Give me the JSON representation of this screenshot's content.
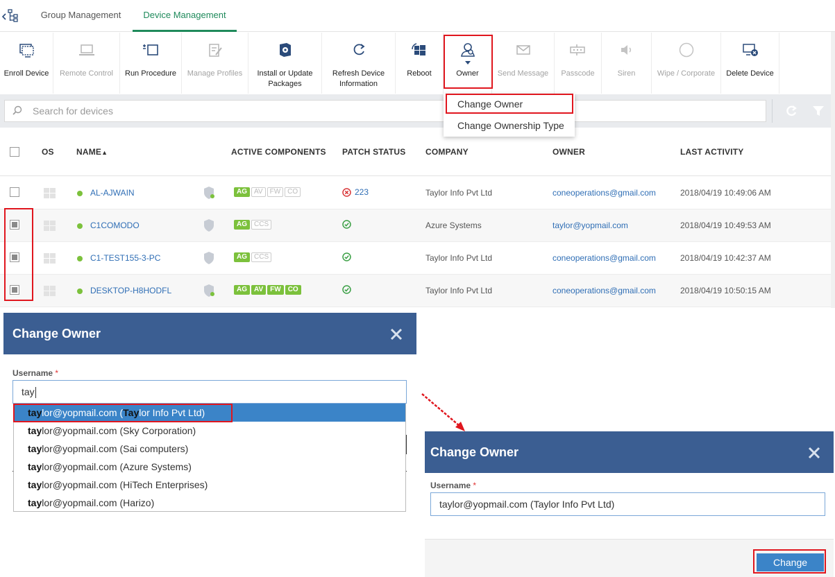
{
  "tabs": [
    {
      "label": "Group Management",
      "active": false
    },
    {
      "label": "Device Management",
      "active": true
    }
  ],
  "toolbar": {
    "enroll": "Enroll Device",
    "remote": "Remote Control",
    "run_procedure": "Run Procedure",
    "manage_profiles": "Manage Profiles",
    "install_line1": "Install or Update",
    "install_line2": "Packages",
    "refresh_line1": "Refresh Device",
    "refresh_line2": "Information",
    "reboot": "Reboot",
    "owner": "Owner",
    "send_message": "Send Message",
    "passcode": "Passcode",
    "siren": "Siren",
    "wipe": "Wipe / Corporate",
    "delete": "Delete Device"
  },
  "search": {
    "placeholder": "Search for devices"
  },
  "owner_menu": {
    "change_owner": "Change Owner",
    "change_ownership_type": "Change Ownership Type"
  },
  "table": {
    "headers": {
      "os": "OS",
      "name": "NAME",
      "active_components": "ACTIVE COMPONENTS",
      "patch_status": "PATCH STATUS",
      "company": "COMPANY",
      "owner": "OWNER",
      "last_activity": "LAST ACTIVITY"
    },
    "rows": [
      {
        "name": "AL-AJWAIN",
        "patch": "223",
        "company": "Taylor Info Pvt Ltd",
        "owner": "coneoperations@gmail.com",
        "last_activity": "2018/04/19 10:49:06 AM",
        "checked": false
      },
      {
        "name": "C1COMODO",
        "patch": "",
        "company": "Azure Systems",
        "owner": "taylor@yopmail.com",
        "last_activity": "2018/04/19 10:49:53 AM",
        "checked": true
      },
      {
        "name": "C1-TEST155-3-PC",
        "patch": "",
        "company": "Taylor Info Pvt Ltd",
        "owner": "coneoperations@gmail.com",
        "last_activity": "2018/04/19 10:42:37 AM",
        "checked": true
      },
      {
        "name": "DESKTOP-H8HODFL",
        "patch": "",
        "company": "Taylor Info Pvt Ltd",
        "owner": "coneoperations@gmail.com",
        "last_activity": "2018/04/19 10:50:15 AM",
        "checked": true
      }
    ],
    "badges": {
      "ag": "AG",
      "av": "AV",
      "fw": "FW",
      "co": "CO",
      "ccs": "CCS"
    }
  },
  "modal1": {
    "title": "Change Owner",
    "username_label": "Username",
    "required_mark": "*",
    "input_value": "tay",
    "suggestions": [
      {
        "bold": "tay",
        "rest": "lor@yopmail.com (",
        "bold2": "Tay",
        "rest2": "lor Info Pvt Ltd)"
      },
      {
        "bold": "tay",
        "rest": "lor@yopmail.com (Sky Corporation)"
      },
      {
        "bold": "tay",
        "rest": "lor@yopmail.com (Sai computers)"
      },
      {
        "bold": "tay",
        "rest": "lor@yopmail.com (Azure Systems)"
      },
      {
        "bold": "tay",
        "rest": "lor@yopmail.com (HiTech Enterprises)"
      },
      {
        "bold": "tay",
        "rest": "lor@yopmail.com (Harizo)"
      }
    ]
  },
  "modal2": {
    "title": "Change Owner",
    "username_label": "Username",
    "required_mark": "*",
    "input_value": "taylor@yopmail.com (Taylor Info Pvt Ltd)",
    "change_button": "Change"
  },
  "colors": {
    "header_blue": "#3b5e92",
    "accent_green": "#1f8a5b",
    "button_blue": "#3b84c8",
    "highlight_red": "#e0161e"
  }
}
